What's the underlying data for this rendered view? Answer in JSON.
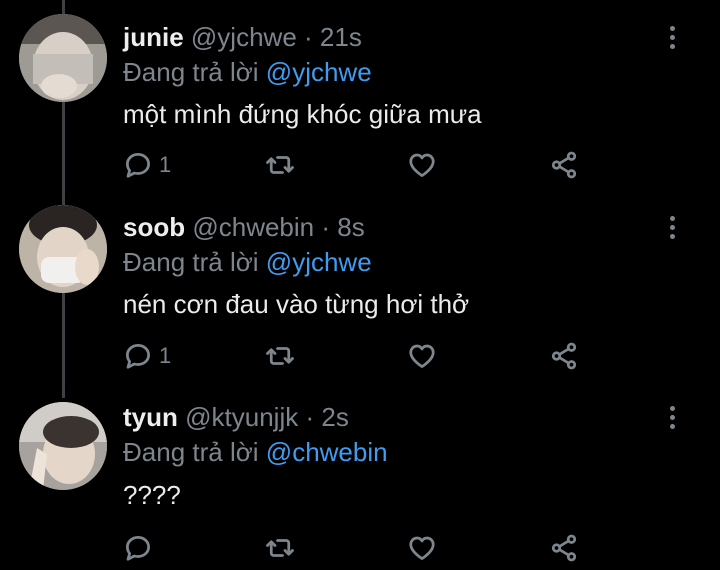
{
  "tweets": [
    {
      "name": "junie",
      "handle": "@yjchwe",
      "separator": "·",
      "time": "21s",
      "reply_prefix": "Đang trả lời",
      "reply_to": "@yjchwe",
      "text": "một mình đứng khóc giữa mưa",
      "reply_count": "1"
    },
    {
      "name": "soob",
      "handle": "@chwebin",
      "separator": "·",
      "time": "8s",
      "reply_prefix": "Đang trả lời",
      "reply_to": "@yjchwe",
      "text": "nén cơn đau vào từng hơi thở",
      "reply_count": "1"
    },
    {
      "name": "tyun",
      "handle": "@ktyunjjk",
      "separator": "·",
      "time": "2s",
      "reply_prefix": "Đang trả lời",
      "reply_to": "@chwebin",
      "text": "????",
      "reply_count": ""
    }
  ],
  "icons": [
    "reply-icon",
    "retweet-icon",
    "like-icon",
    "share-icon",
    "more-options-icon"
  ],
  "colors": {
    "background": "#000000",
    "mention": "#3f9cf0",
    "muted": "#7e868d",
    "text": "#ebebeb"
  }
}
